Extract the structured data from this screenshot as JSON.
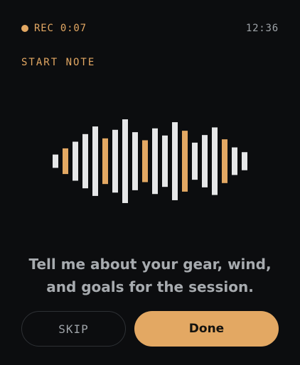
{
  "status_bar": {
    "recording_label": "REC 0:07",
    "clock": "12:36"
  },
  "section_label": "START NOTE",
  "waveform": {
    "accent_color": "#e3a863",
    "base_color": "#e6e7e8",
    "bars": [
      {
        "level": 0.14,
        "accent": false
      },
      {
        "level": 0.27,
        "accent": true
      },
      {
        "level": 0.41,
        "accent": false
      },
      {
        "level": 0.57,
        "accent": false
      },
      {
        "level": 0.73,
        "accent": false
      },
      {
        "level": 0.48,
        "accent": true
      },
      {
        "level": 0.66,
        "accent": false
      },
      {
        "level": 0.88,
        "accent": false
      },
      {
        "level": 0.61,
        "accent": false
      },
      {
        "level": 0.44,
        "accent": true
      },
      {
        "level": 0.69,
        "accent": false
      },
      {
        "level": 0.54,
        "accent": false
      },
      {
        "level": 0.82,
        "accent": false
      },
      {
        "level": 0.64,
        "accent": true
      },
      {
        "level": 0.39,
        "accent": false
      },
      {
        "level": 0.55,
        "accent": false
      },
      {
        "level": 0.71,
        "accent": false
      },
      {
        "level": 0.46,
        "accent": true
      },
      {
        "level": 0.29,
        "accent": false
      },
      {
        "level": 0.19,
        "accent": false
      }
    ]
  },
  "prompt": "Tell me about your gear, wind, and goals for the session.",
  "actions": {
    "skip_label": "SKIP",
    "done_label": "Done"
  }
}
